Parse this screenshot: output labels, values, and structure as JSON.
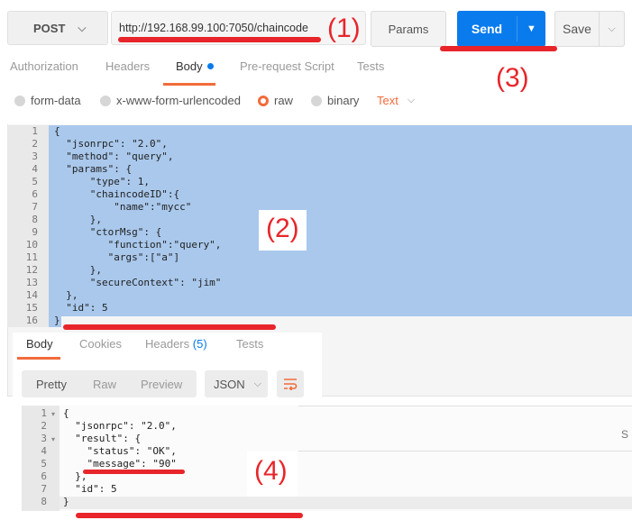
{
  "request": {
    "method": "POST",
    "url": "http://192.168.99.100:7050/chaincode",
    "params_label": "Params",
    "send_label": "Send",
    "save_label": "Save"
  },
  "request_tabs": [
    {
      "label": "Authorization"
    },
    {
      "label": "Headers"
    },
    {
      "label": "Body"
    },
    {
      "label": "Pre-request Script"
    },
    {
      "label": "Tests"
    }
  ],
  "body_types": [
    {
      "label": "form-data",
      "selected": false
    },
    {
      "label": "x-www-form-urlencoded",
      "selected": false
    },
    {
      "label": "raw",
      "selected": true
    },
    {
      "label": "binary",
      "selected": false
    }
  ],
  "raw_format": "Text",
  "request_body": {
    "line_numbers": [
      "1",
      "2",
      "3",
      "4",
      "5",
      "6",
      "7",
      "8",
      "9",
      "10",
      "11",
      "12",
      "13",
      "14",
      "15",
      "16"
    ],
    "lines": [
      "{",
      "  \"jsonrpc\": \"2.0\",",
      "  \"method\": \"query\",",
      "  \"params\": {",
      "      \"type\": 1,",
      "      \"chaincodeID\":{",
      "          \"name\":\"mycc\"",
      "      },",
      "      \"ctorMsg\": {",
      "         \"function\":\"query\",",
      "         \"args\":[\"a\"]",
      "      },",
      "      \"secureContext\": \"jim\"",
      "  },",
      "  \"id\": 5",
      "}"
    ]
  },
  "response_tabs": [
    {
      "label": "Body"
    },
    {
      "label": "Cookies"
    },
    {
      "label": "Headers",
      "count": "(5)"
    },
    {
      "label": "Tests"
    }
  ],
  "view_modes": [
    {
      "label": "Pretty",
      "active": true
    },
    {
      "label": "Raw",
      "active": false
    },
    {
      "label": "Preview",
      "active": false
    }
  ],
  "response_format": "JSON",
  "response_body": {
    "line_numbers": [
      "1",
      "2",
      "3",
      "4",
      "5",
      "6",
      "7",
      "8"
    ],
    "lines": [
      "{",
      "  \"jsonrpc\": \"2.0\",",
      "  \"result\": {",
      "    \"status\": \"OK\",",
      "    \"message\": \"90\"",
      "  },",
      "  \"id\": 5",
      "}"
    ],
    "side_text": "S"
  },
  "annotations": [
    {
      "label": "(1)"
    },
    {
      "label": "(2)"
    },
    {
      "label": "(3)"
    },
    {
      "label": "(4)"
    }
  ],
  "colors": {
    "accent": "#f26b3a",
    "send": "#097bed",
    "annotation": "#e8252a",
    "selection": "#a9c8ec"
  }
}
